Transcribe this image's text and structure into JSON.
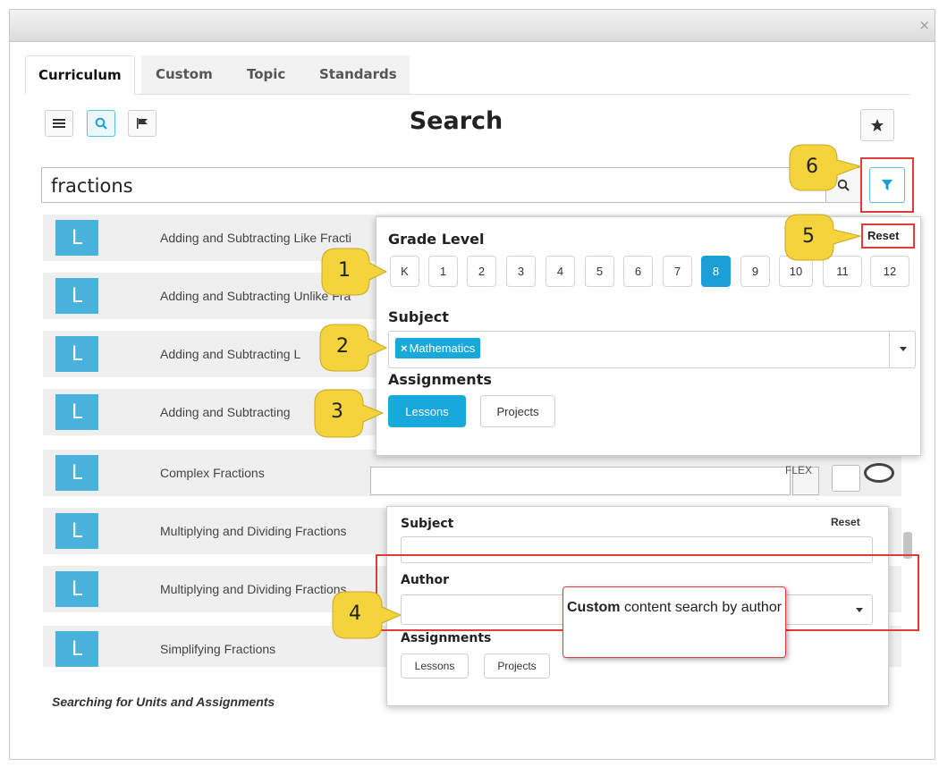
{
  "window": {
    "close_label": "×"
  },
  "tabs": [
    {
      "label": "Curriculum",
      "active": true
    },
    {
      "label": "Custom"
    },
    {
      "label": "Topic"
    },
    {
      "label": "Standards"
    }
  ],
  "toolbar": {
    "icons": [
      "list-icon",
      "search-icon",
      "flag-icon",
      "star-icon"
    ]
  },
  "page": {
    "title": "Search"
  },
  "search": {
    "value": "fractions"
  },
  "results": [
    {
      "badge": "L",
      "title": "Adding and Subtracting Like Fracti"
    },
    {
      "badge": "L",
      "title": "Adding and Subtracting Unlike Fra"
    },
    {
      "badge": "L",
      "title": "Adding and Subtracting L"
    },
    {
      "badge": "L",
      "title": "Adding and Subtracting"
    },
    {
      "badge": "L",
      "title": "Complex Fractions"
    },
    {
      "badge": "L",
      "title": "Multiplying and Dividing Fractions"
    },
    {
      "badge": "L",
      "title": "Multiplying and Dividing Fractions"
    },
    {
      "badge": "L",
      "title": "Simplifying Fractions"
    }
  ],
  "footer": {
    "caption": "Searching for Units and Assignments"
  },
  "filter_panel": {
    "grade_label": "Grade Level",
    "reset_label": "Reset",
    "grades": [
      "K",
      "1",
      "2",
      "3",
      "4",
      "5",
      "6",
      "7",
      "8",
      "9",
      "10",
      "11",
      "12"
    ],
    "selected_grade": "8",
    "subject_label": "Subject",
    "subject_chip": "Mathematics",
    "assignments_label": "Assignments",
    "assignments": [
      {
        "label": "Lessons",
        "selected": true
      },
      {
        "label": "Projects",
        "selected": false
      }
    ]
  },
  "custom_panel": {
    "partial_text": "FLEX",
    "subject_label": "Subject",
    "reset_label": "Reset",
    "author_label": "Author",
    "assignments_label": "Assignments",
    "assignments": [
      {
        "label": "Lessons"
      },
      {
        "label": "Projects"
      }
    ]
  },
  "callouts": [
    "1",
    "2",
    "3",
    "4",
    "5",
    "6"
  ],
  "tooltip": {
    "bold": "Custom",
    "rest": " content search by author"
  },
  "colors": {
    "accent": "#1b9fd6",
    "highlight_border": "#e03c3c",
    "callout_yellow": "#f5d33c"
  }
}
